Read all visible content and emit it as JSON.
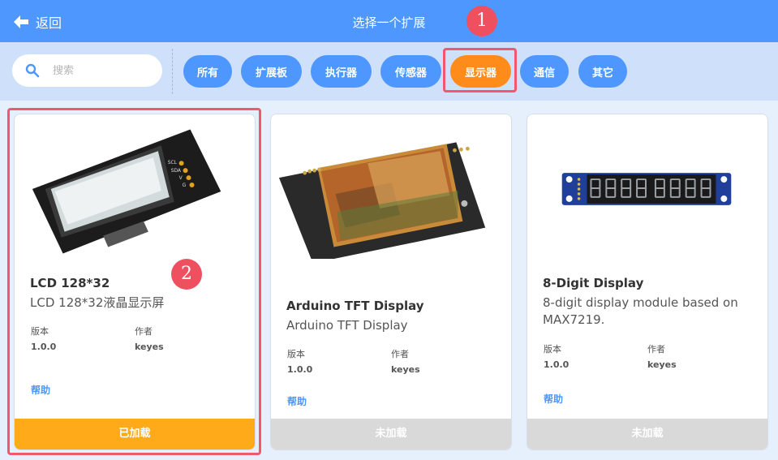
{
  "header": {
    "back_label": "返回",
    "title": "选择一个扩展"
  },
  "markers": [
    "1",
    "2"
  ],
  "search": {
    "placeholder": "搜索",
    "value": ""
  },
  "categories": [
    {
      "label": "所有",
      "active": false
    },
    {
      "label": "扩展板",
      "active": false
    },
    {
      "label": "执行器",
      "active": false
    },
    {
      "label": "传感器",
      "active": false
    },
    {
      "label": "显示器",
      "active": true
    },
    {
      "label": "通信",
      "active": false
    },
    {
      "label": "其它",
      "active": false
    }
  ],
  "cards": [
    {
      "title": "LCD 128*32",
      "description": "LCD 128*32液晶显示屏",
      "version_label": "版本",
      "version": "1.0.0",
      "author_label": "作者",
      "author": "keyes",
      "help_label": "帮助",
      "status": "已加载",
      "loaded": true
    },
    {
      "title": "Arduino TFT Display",
      "description": "Arduino TFT Display",
      "version_label": "版本",
      "version": "1.0.0",
      "author_label": "作者",
      "author": "keyes",
      "help_label": "帮助",
      "status": "未加载",
      "loaded": false
    },
    {
      "title": "8-Digit Display",
      "description": "8-digit display module based on MAX7219.",
      "version_label": "版本",
      "version": "1.0.0",
      "author_label": "作者",
      "author": "keyes",
      "help_label": "帮助",
      "status": "未加载",
      "loaded": false
    }
  ],
  "module_pin_labels": [
    "SCL",
    "SDA",
    "V",
    "G"
  ],
  "colors": {
    "header_blue": "#4d97ff",
    "active_orange": "#ff8c1a",
    "loaded_footer": "#ffab19",
    "unloaded_footer": "#d9d9d9",
    "highlight_red": "#f05870"
  }
}
